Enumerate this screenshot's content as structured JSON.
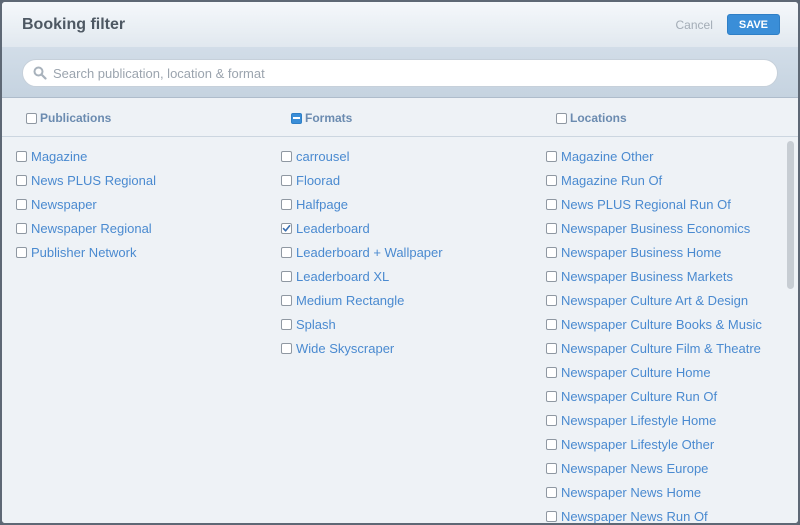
{
  "header": {
    "title": "Booking filter",
    "cancel_label": "Cancel",
    "save_label": "SAVE"
  },
  "search": {
    "placeholder": "Search publication, location & format"
  },
  "columns": {
    "publications": {
      "label": "Publications",
      "state": "unchecked",
      "items": [
        {
          "label": "Magazine",
          "checked": false
        },
        {
          "label": "News PLUS Regional",
          "checked": false
        },
        {
          "label": "Newspaper",
          "checked": false
        },
        {
          "label": "Newspaper Regional",
          "checked": false
        },
        {
          "label": "Publisher Network",
          "checked": false
        }
      ]
    },
    "formats": {
      "label": "Formats",
      "state": "indeterminate",
      "items": [
        {
          "label": "carrousel",
          "checked": false
        },
        {
          "label": "Floorad",
          "checked": false
        },
        {
          "label": "Halfpage",
          "checked": false
        },
        {
          "label": "Leaderboard",
          "checked": true
        },
        {
          "label": "Leaderboard + Wallpaper",
          "checked": false
        },
        {
          "label": "Leaderboard XL",
          "checked": false
        },
        {
          "label": "Medium Rectangle",
          "checked": false
        },
        {
          "label": "Splash",
          "checked": false
        },
        {
          "label": "Wide Skyscraper",
          "checked": false
        }
      ]
    },
    "locations": {
      "label": "Locations",
      "state": "unchecked",
      "items": [
        {
          "label": "Magazine Other",
          "checked": false
        },
        {
          "label": "Magazine Run Of",
          "checked": false
        },
        {
          "label": "News PLUS Regional Run Of",
          "checked": false
        },
        {
          "label": "Newspaper Business Economics",
          "checked": false
        },
        {
          "label": "Newspaper Business Home",
          "checked": false
        },
        {
          "label": "Newspaper Business Markets",
          "checked": false
        },
        {
          "label": "Newspaper Culture Art & Design",
          "checked": false
        },
        {
          "label": "Newspaper Culture Books & Music",
          "checked": false
        },
        {
          "label": "Newspaper Culture Film & Theatre",
          "checked": false
        },
        {
          "label": "Newspaper Culture Home",
          "checked": false
        },
        {
          "label": "Newspaper Culture Run Of",
          "checked": false
        },
        {
          "label": "Newspaper Lifestyle Home",
          "checked": false
        },
        {
          "label": "Newspaper Lifestyle Other",
          "checked": false
        },
        {
          "label": "Newspaper News Europe",
          "checked": false
        },
        {
          "label": "Newspaper News Home",
          "checked": false
        },
        {
          "label": "Newspaper News Run Of",
          "checked": false
        }
      ]
    }
  },
  "colors": {
    "accent": "#3a8ed8",
    "link": "#4a8ad0",
    "header_label": "#6b8bb0"
  },
  "icons": {
    "search": "search-icon",
    "check": "checkmark-icon"
  }
}
